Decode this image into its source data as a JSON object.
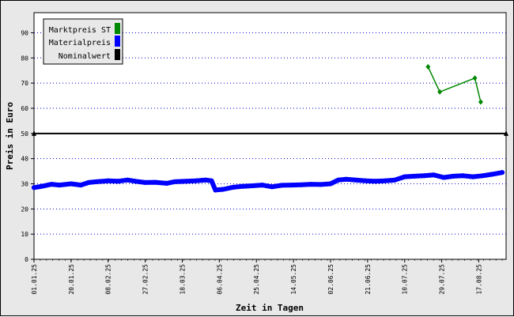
{
  "chart_data": {
    "type": "line",
    "title": "",
    "xlabel": "Zeit in Tagen",
    "ylabel": "Preis in Euro",
    "ylim": [
      0,
      98
    ],
    "yticks": [
      0,
      10,
      20,
      30,
      40,
      50,
      60,
      70,
      80,
      90
    ],
    "xlim": [
      "01.01.25",
      "31.08.25"
    ],
    "xticks": [
      "01.01.25",
      "20.01.25",
      "08.02.25",
      "27.02.25",
      "18.03.25",
      "06.04.25",
      "25.04.25",
      "14.05.25",
      "02.06.25",
      "21.06.25",
      "10.07.25",
      "29.07.25",
      "17.08.25"
    ],
    "grid": "horizontal dotted",
    "legend_position": "top-left",
    "series": [
      {
        "name": "Marktpreis ST",
        "color": "#008800",
        "marker": "diamond",
        "points": [
          [
            "22.07.25",
            76.5
          ],
          [
            "28.07.25",
            66.5
          ],
          [
            "15.08.25",
            72
          ],
          [
            "18.08.25",
            62.5
          ]
        ]
      },
      {
        "name": "Materialpreis",
        "color": "#0000ff",
        "points": [
          [
            "01.01.25",
            28.5
          ],
          [
            "05.01.25",
            29
          ],
          [
            "10.01.25",
            29.8
          ],
          [
            "14.01.25",
            29.5
          ],
          [
            "20.01.25",
            30
          ],
          [
            "25.01.25",
            29.5
          ],
          [
            "29.01.25",
            30.5
          ],
          [
            "02.02.25",
            30.8
          ],
          [
            "08.02.25",
            31.2
          ],
          [
            "13.02.25",
            31
          ],
          [
            "18.02.25",
            31.5
          ],
          [
            "22.02.25",
            31
          ],
          [
            "27.02.25",
            30.5
          ],
          [
            "04.03.25",
            30.6
          ],
          [
            "10.03.25",
            30.2
          ],
          [
            "14.03.25",
            30.8
          ],
          [
            "20.03.25",
            31
          ],
          [
            "25.03.25",
            31.2
          ],
          [
            "30.03.25",
            31.5
          ],
          [
            "02.04.25",
            31.2
          ],
          [
            "04.04.25",
            27.5
          ],
          [
            "08.04.25",
            27.8
          ],
          [
            "13.04.25",
            28.6
          ],
          [
            "18.04.25",
            29
          ],
          [
            "23.04.25",
            29.2
          ],
          [
            "28.04.25",
            29.5
          ],
          [
            "03.05.25",
            28.8
          ],
          [
            "08.05.25",
            29.4
          ],
          [
            "13.05.25",
            29.5
          ],
          [
            "18.05.25",
            29.6
          ],
          [
            "23.05.25",
            29.8
          ],
          [
            "28.05.25",
            29.7
          ],
          [
            "02.06.25",
            30
          ],
          [
            "06.06.25",
            31.5
          ],
          [
            "10.06.25",
            31.8
          ],
          [
            "15.06.25",
            31.5
          ],
          [
            "20.06.25",
            31.2
          ],
          [
            "25.06.25",
            31
          ],
          [
            "30.06.25",
            31.2
          ],
          [
            "05.07.25",
            31.5
          ],
          [
            "10.07.25",
            32.8
          ],
          [
            "15.07.25",
            33
          ],
          [
            "20.07.25",
            33.2
          ],
          [
            "25.07.25",
            33.5
          ],
          [
            "30.07.25",
            32.5
          ],
          [
            "04.08.25",
            33
          ],
          [
            "09.08.25",
            33.2
          ],
          [
            "14.08.25",
            32.8
          ],
          [
            "19.08.25",
            33.2
          ],
          [
            "24.08.25",
            33.8
          ],
          [
            "29.08.25",
            34.5
          ]
        ]
      },
      {
        "name": "Nominalwert",
        "color": "#000000",
        "marker": "triangle",
        "points": [
          [
            "01.01.25",
            50
          ],
          [
            "31.08.25",
            50
          ]
        ]
      }
    ]
  }
}
